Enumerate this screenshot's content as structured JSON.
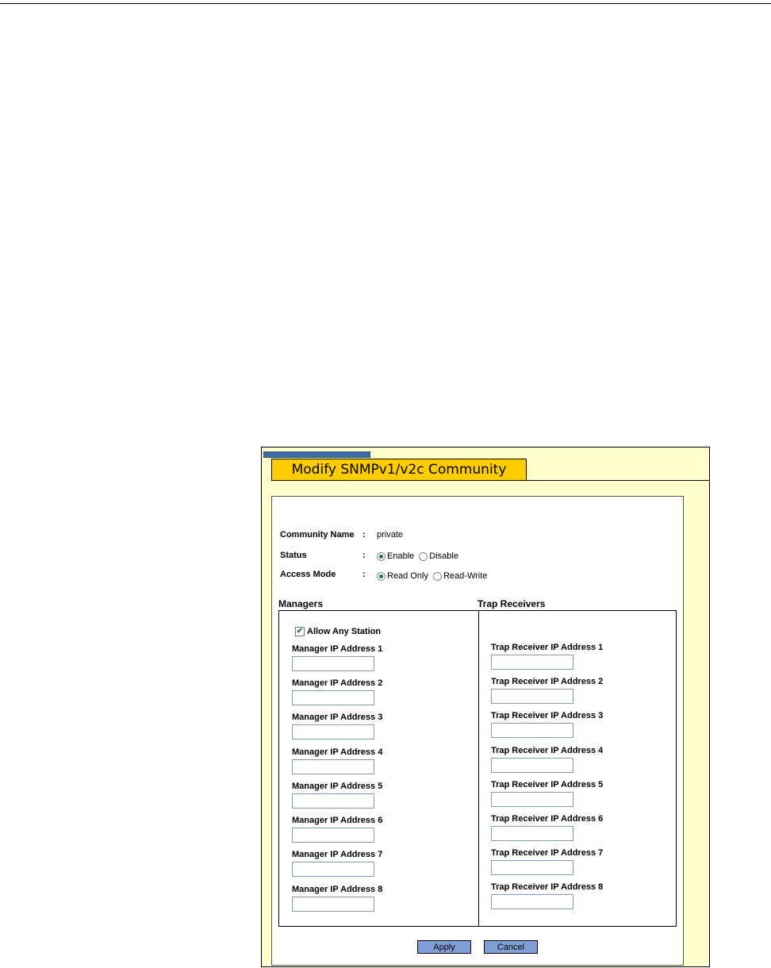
{
  "window": {
    "title": "Modify SNMPv1/v2c Community"
  },
  "form": {
    "community_name_label": "Community Name",
    "community_name_value": "private",
    "status_label": "Status",
    "status_options": [
      "Enable",
      "Disable"
    ],
    "status_selected": "Enable",
    "access_mode_label": "Access Mode",
    "access_mode_options": [
      "Read Only",
      "Read-Write"
    ],
    "access_mode_selected": "Read Only",
    "colon": ":"
  },
  "managers": {
    "heading": "Managers",
    "allow_any_station_label": "Allow Any Station",
    "allow_any_station_checked": true,
    "fields": [
      {
        "label": "Manager IP Address 1",
        "value": ""
      },
      {
        "label": "Manager IP Address 2",
        "value": ""
      },
      {
        "label": "Manager IP Address 3",
        "value": ""
      },
      {
        "label": "Manager IP Address 4",
        "value": ""
      },
      {
        "label": "Manager IP Address 5",
        "value": ""
      },
      {
        "label": "Manager IP Address 6",
        "value": ""
      },
      {
        "label": "Manager IP Address 7",
        "value": ""
      },
      {
        "label": "Manager IP Address 8",
        "value": ""
      }
    ]
  },
  "trap_receivers": {
    "heading": "Trap Receivers",
    "fields": [
      {
        "label": "Trap Receiver IP Address 1",
        "value": ""
      },
      {
        "label": "Trap Receiver IP Address 2",
        "value": ""
      },
      {
        "label": "Trap Receiver IP Address 3",
        "value": ""
      },
      {
        "label": "Trap Receiver IP Address 4",
        "value": ""
      },
      {
        "label": "Trap Receiver IP Address 5",
        "value": ""
      },
      {
        "label": "Trap Receiver IP Address 6",
        "value": ""
      },
      {
        "label": "Trap Receiver IP Address 7",
        "value": ""
      },
      {
        "label": "Trap Receiver IP Address 8",
        "value": ""
      }
    ]
  },
  "buttons": {
    "apply": "Apply",
    "cancel": "Cancel"
  },
  "colors": {
    "panel_bg": "#ffffcc",
    "title_tab": "#ffcc00",
    "accent": "#3a6ea5",
    "button": "#7f9fd6",
    "radio_dot": "#1f7a3a"
  }
}
